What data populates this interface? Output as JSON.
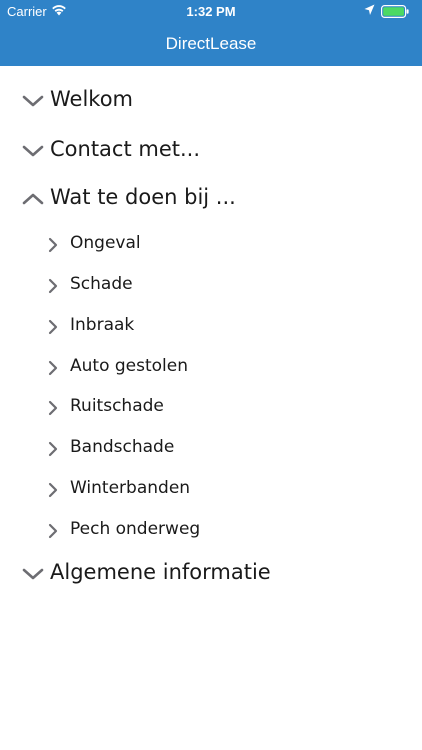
{
  "status_bar": {
    "carrier": "Carrier",
    "time": "1:32 PM",
    "icons": [
      "wifi-icon",
      "location-arrow-icon",
      "battery-icon"
    ]
  },
  "nav": {
    "title": "DirectLease"
  },
  "colors": {
    "header": "#2f83c8",
    "battery": "#4cd964"
  },
  "menu": {
    "welkom": "Welkom",
    "contact": "Contact met...",
    "wat_te_doen": "Wat te doen bij ...",
    "sub_items": [
      "Ongeval",
      "Schade",
      "Inbraak",
      "Auto gestolen",
      "Ruitschade",
      "Bandschade",
      "Winterbanden",
      "Pech onderweg"
    ],
    "algemeen": "Algemene informatie"
  }
}
